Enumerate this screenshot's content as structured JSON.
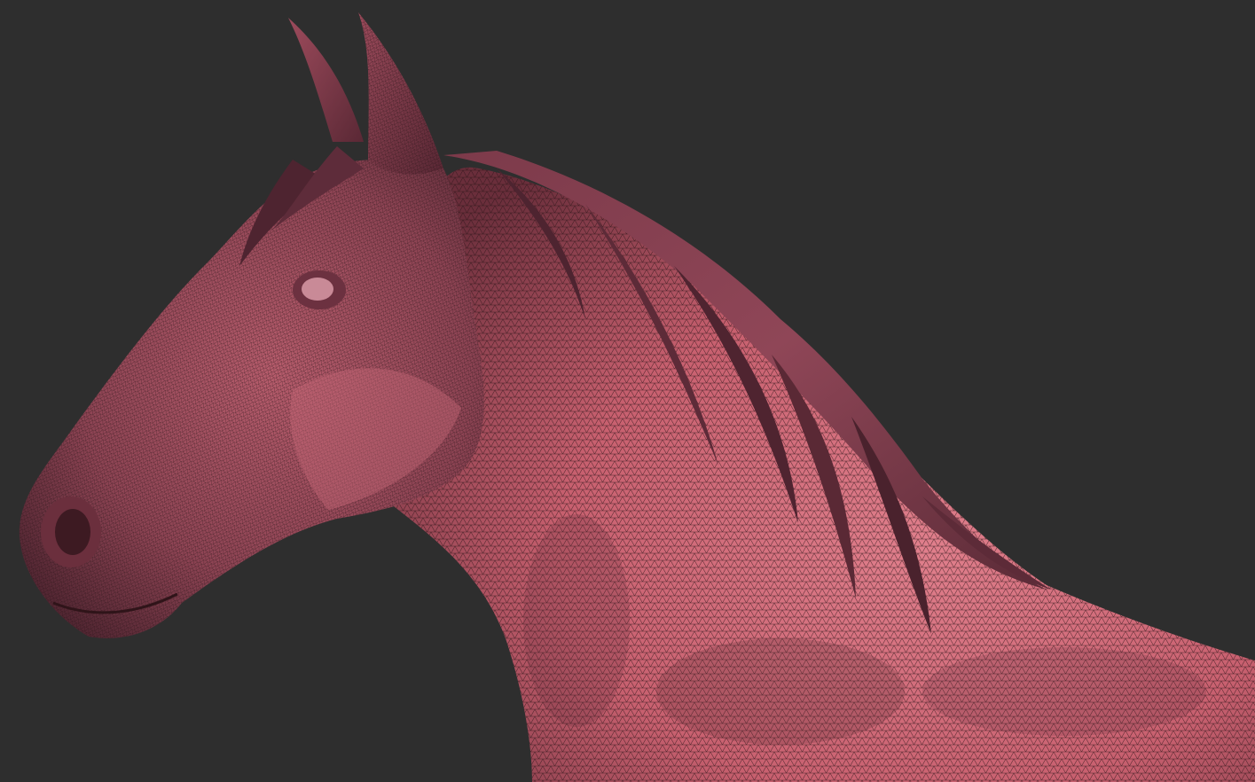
{
  "viewport": {
    "background_color": "#2e2e2e",
    "model": {
      "subject": "horse-head-and-neck",
      "display_mode": "wireframe-on-shaded",
      "surface_color": "#d8707e",
      "shadow_color": "#5a2a35",
      "wire_color": "#2a1418"
    }
  }
}
